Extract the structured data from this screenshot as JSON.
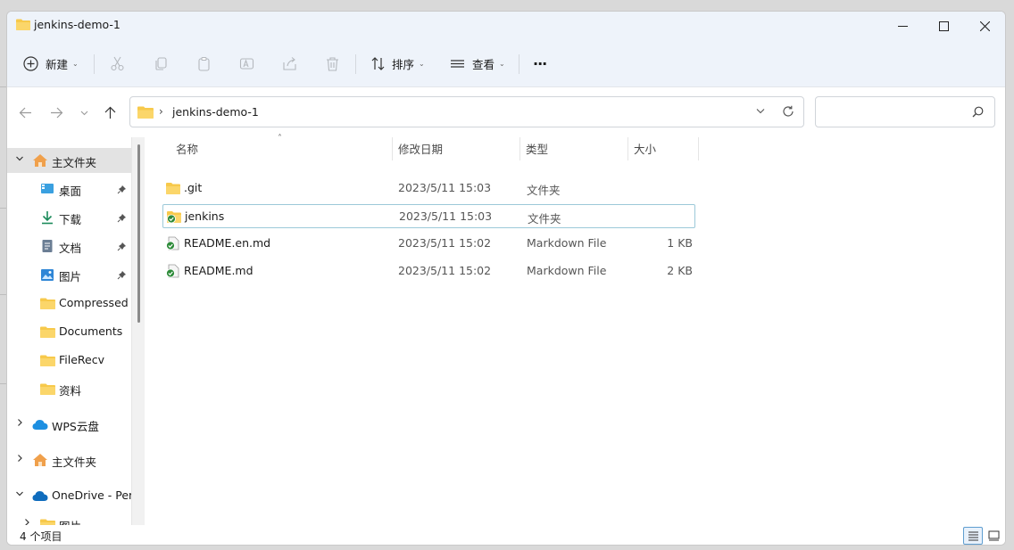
{
  "window": {
    "title": "jenkins-demo-1",
    "controls": {
      "minimize": "minimize",
      "maximize": "maximize",
      "close": "close"
    }
  },
  "toolbar": {
    "new_label": "新建",
    "sort_label": "排序",
    "view_label": "查看",
    "more_label": "···"
  },
  "address": {
    "crumb": "jenkins-demo-1",
    "search_placeholder": ""
  },
  "sidebar": {
    "items": [
      {
        "label": "主文件夹",
        "icon": "home-icon"
      },
      {
        "label": "桌面",
        "icon": "desktop-icon",
        "pinned": true
      },
      {
        "label": "下载",
        "icon": "download-icon",
        "pinned": true
      },
      {
        "label": "文档",
        "icon": "document-icon",
        "pinned": true
      },
      {
        "label": "图片",
        "icon": "picture-icon",
        "pinned": true
      },
      {
        "label": "Compressed",
        "icon": "folder-icon"
      },
      {
        "label": "Documents",
        "icon": "folder-icon"
      },
      {
        "label": "FileRecv",
        "icon": "folder-icon"
      },
      {
        "label": "资料",
        "icon": "folder-icon"
      },
      {
        "label": "WPS云盘",
        "icon": "cloud-icon"
      },
      {
        "label": "主文件夹",
        "icon": "home-icon"
      },
      {
        "label": "OneDrive - Pers",
        "icon": "onedrive-icon"
      },
      {
        "label": "图片",
        "icon": "folder-icon"
      }
    ]
  },
  "columns": {
    "name": "名称",
    "date": "修改日期",
    "type": "类型",
    "size": "大小"
  },
  "files": [
    {
      "name": ".git",
      "date": "2023/5/11 15:03",
      "type": "文件夹",
      "size": "",
      "icon": "folder-icon"
    },
    {
      "name": "jenkins",
      "date": "2023/5/11 15:03",
      "type": "文件夹",
      "size": "",
      "icon": "synced-folder-icon"
    },
    {
      "name": "README.en.md",
      "date": "2023/5/11 15:02",
      "type": "Markdown File",
      "size": "1 KB",
      "icon": "synced-file-icon"
    },
    {
      "name": "README.md",
      "date": "2023/5/11 15:02",
      "type": "Markdown File",
      "size": "2 KB",
      "icon": "synced-file-icon"
    }
  ],
  "status": {
    "count": "4 个项目"
  },
  "colors": {
    "folder": "#f7c94b",
    "accent": "#0067c0",
    "sync_green": "#2e8b3a",
    "selection": "#e3e3e3"
  }
}
